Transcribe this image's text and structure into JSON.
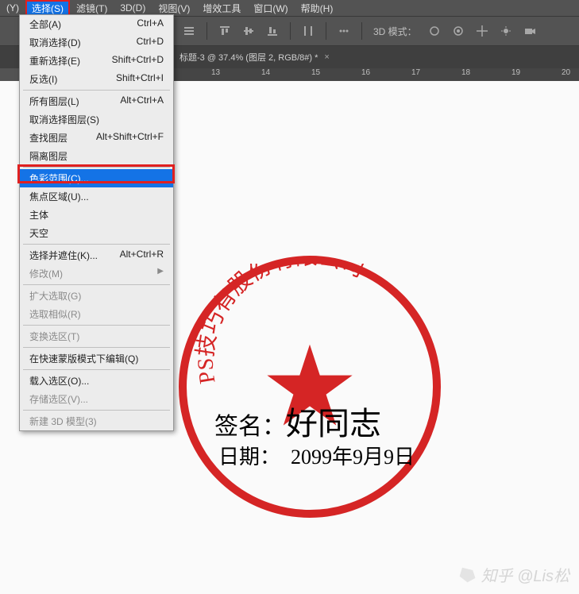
{
  "menubar": {
    "items": [
      {
        "label": "(Y)",
        "active": false
      },
      {
        "label": "选择(S)",
        "active": true
      },
      {
        "label": "滤镜(T)",
        "active": false
      },
      {
        "label": "3D(D)",
        "active": false
      },
      {
        "label": "视图(V)",
        "active": false
      },
      {
        "label": "增效工具",
        "active": false
      },
      {
        "label": "窗口(W)",
        "active": false
      },
      {
        "label": "帮助(H)",
        "active": false
      }
    ]
  },
  "toolbar": {
    "mode3d_label": "3D 模式："
  },
  "tab": {
    "title": "标题-3 @ 37.4% (图层 2, RGB/8#) *",
    "close": "×"
  },
  "ruler": {
    "ticks": [
      "13",
      "14",
      "15",
      "16",
      "17",
      "18",
      "19",
      "20"
    ]
  },
  "dropdown": {
    "groups": [
      [
        {
          "label": "全部(A)",
          "shortcut": "Ctrl+A",
          "disabled": false
        },
        {
          "label": "取消选择(D)",
          "shortcut": "Ctrl+D",
          "disabled": false
        },
        {
          "label": "重新选择(E)",
          "shortcut": "Shift+Ctrl+D",
          "disabled": false
        },
        {
          "label": "反选(I)",
          "shortcut": "Shift+Ctrl+I",
          "disabled": false
        }
      ],
      [
        {
          "label": "所有图层(L)",
          "shortcut": "Alt+Ctrl+A",
          "disabled": false
        },
        {
          "label": "取消选择图层(S)",
          "shortcut": "",
          "disabled": false
        },
        {
          "label": "查找图层",
          "shortcut": "Alt+Shift+Ctrl+F",
          "disabled": false
        },
        {
          "label": "隔离图层",
          "shortcut": "",
          "disabled": false
        }
      ],
      [
        {
          "label": "色彩范围(C)...",
          "shortcut": "",
          "disabled": false,
          "highlighted": true
        },
        {
          "label": "焦点区域(U)...",
          "shortcut": "",
          "disabled": false
        },
        {
          "label": "主体",
          "shortcut": "",
          "disabled": false
        },
        {
          "label": "天空",
          "shortcut": "",
          "disabled": false
        }
      ],
      [
        {
          "label": "选择并遮住(K)...",
          "shortcut": "Alt+Ctrl+R",
          "disabled": false
        },
        {
          "label": "修改(M)",
          "shortcut": "",
          "disabled": true,
          "submenu": true
        }
      ],
      [
        {
          "label": "扩大选取(G)",
          "shortcut": "",
          "disabled": true
        },
        {
          "label": "选取相似(R)",
          "shortcut": "",
          "disabled": true
        }
      ],
      [
        {
          "label": "变换选区(T)",
          "shortcut": "",
          "disabled": true
        }
      ],
      [
        {
          "label": "在快速蒙版模式下编辑(Q)",
          "shortcut": "",
          "disabled": false
        }
      ],
      [
        {
          "label": "载入选区(O)...",
          "shortcut": "",
          "disabled": false
        },
        {
          "label": "存储选区(V)...",
          "shortcut": "",
          "disabled": true
        }
      ],
      [
        {
          "label": "新建 3D 模型(3)",
          "shortcut": "",
          "disabled": true
        }
      ]
    ]
  },
  "canvas": {
    "stamp_arc_text": "PS技巧有股份有限公司",
    "signature_label": "签名：",
    "signature_value": "好同志",
    "date_label": "日期：",
    "date_value": "2099年9月9日"
  },
  "watermark": {
    "text": "知乎 @Lis松"
  }
}
